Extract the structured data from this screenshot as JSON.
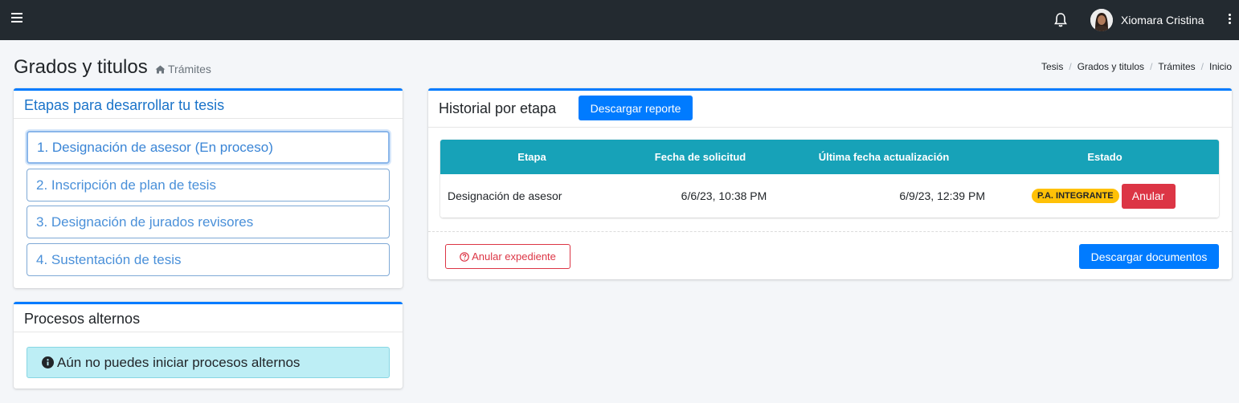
{
  "topbar": {
    "user_name": "Xiomara Cristina",
    "icons": [
      "hamburger-menu-icon",
      "bell-icon",
      "avatar",
      "kebab-menu-icon"
    ]
  },
  "header": {
    "title": "Grados y titulos",
    "subtitle": "Trámites",
    "breadcrumb": [
      "Tesis",
      "Grados y titulos",
      "Trámites",
      "Inicio"
    ]
  },
  "stages_card": {
    "title": "Etapas para desarrollar tu tesis",
    "items": [
      "1. Designación de asesor (En proceso)",
      "2. Inscripción de plan de tesis",
      "3. Designación de jurados revisores",
      "4. Sustentación de tesis"
    ]
  },
  "alt_card": {
    "title": "Procesos alternos",
    "alert": "Aún no puedes iniciar procesos alternos"
  },
  "history_card": {
    "title": "Historial por etapa",
    "report_button": "Descargar reporte",
    "columns": [
      "Etapa",
      "Fecha de solicitud",
      "Última fecha actualización",
      "Estado"
    ],
    "rows": [
      {
        "etapa": "Designación de asesor",
        "fecha_solicitud": "6/6/23, 10:38 PM",
        "ultima_actualizacion": "6/9/23, 12:39 PM",
        "estado": "P.A. INTEGRANTE",
        "action": "Anular"
      }
    ],
    "cancel_file_button": "Anular expediente",
    "download_docs_button": "Descargar documentos"
  },
  "colors": {
    "topbar": "#232a30",
    "primary": "#007bff",
    "info": "#17a2b8",
    "warning": "#ffc107",
    "danger": "#dc3545"
  }
}
